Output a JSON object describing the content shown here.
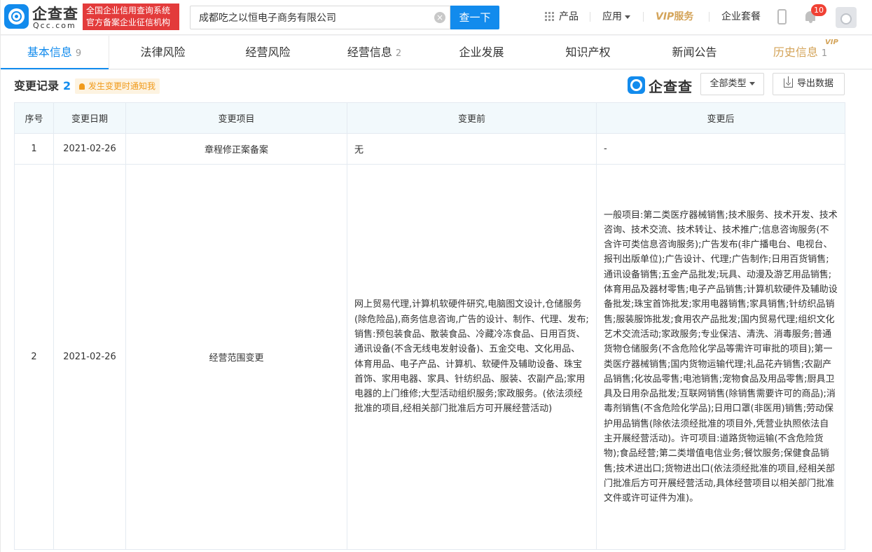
{
  "header": {
    "logo_name": "企查查",
    "logo_sub": "Qcc.com",
    "tagline_line1": "全国企业信用查询系统",
    "tagline_line2": "官方备案企业征信机构",
    "search_value": "成都吃之以恒电子商务有限公司",
    "search_button": "查一下",
    "nav_product": "产品",
    "nav_apps": "应用",
    "nav_vip": "VIP",
    "nav_vip_service": "服务",
    "nav_enterprise": "企业套餐",
    "notification_count": "10"
  },
  "tabs": [
    {
      "label": "基本信息",
      "count": "9"
    },
    {
      "label": "法律风险",
      "count": ""
    },
    {
      "label": "经营风险",
      "count": ""
    },
    {
      "label": "经营信息",
      "count": "2"
    },
    {
      "label": "企业发展",
      "count": ""
    },
    {
      "label": "知识产权",
      "count": ""
    },
    {
      "label": "新闻公告",
      "count": ""
    },
    {
      "label": "历史信息",
      "count": "1"
    }
  ],
  "vip_tag": "VIP",
  "section": {
    "title": "变更记录",
    "count": "2",
    "notify_label": "发生变更时通知我",
    "watermark": "企查查",
    "filter_label": "全部类型",
    "export_label": "导出数据"
  },
  "table": {
    "headers": [
      "序号",
      "变更日期",
      "变更项目",
      "变更前",
      "变更后"
    ],
    "rows": [
      {
        "index": "1",
        "date": "2021-02-26",
        "item": "章程修正案备案",
        "before": "无",
        "after": "-"
      },
      {
        "index": "2",
        "date": "2021-02-26",
        "item": "经营范围变更",
        "before": "网上贸易代理,计算机软硬件研究,电脑图文设计,仓储服务(除危险品),商务信息咨询,广告的设计、制作、代理、发布;销售:预包装食品、散装食品、冷藏冷冻食品、日用百货、通讯设备(不含无线电发射设备)、五金交电、文化用品、体育用品、电子产品、计算机、软硬件及辅助设备、珠宝首饰、家用电器、家具、针纺织品、服装、农副产品;家用电器的上门维修;大型活动组织服务;家政服务。(依法须经批准的项目,经相关部门批准后方可开展经营活动)",
        "after": "一般项目:第二类医疗器械销售;技术服务、技术开发、技术咨询、技术交流、技术转让、技术推广;信息咨询服务(不含许可类信息咨询服务);广告发布(非广播电台、电视台、报刊出版单位);广告设计、代理;广告制作;日用百货销售;通讯设备销售;五金产品批发;玩具、动漫及游艺用品销售;体育用品及器材零售;电子产品销售;计算机软硬件及辅助设备批发;珠宝首饰批发;家用电器销售;家具销售;针纺织品销售;服装服饰批发;食用农产品批发;国内贸易代理;组织文化艺术交流活动;家政服务;专业保洁、清洗、消毒服务;普通货物仓储服务(不含危险化学品等需许可审批的项目);第一类医疗器械销售;国内货物运输代理;礼品花卉销售;农副产品销售;化妆品零售;电池销售;宠物食品及用品零售;厨具卫具及日用杂品批发;互联网销售(除销售需要许可的商品);消毒剂销售(不含危险化学品);日用口罩(非医用)销售;劳动保护用品销售(除依法须经批准的项目外,凭营业执照依法自主开展经营活动)。许可项目:道路货物运输(不含危险货物);食品经营;第二类增值电信业务;餐饮服务;保健食品销售;技术进出口;货物进出口(依法须经批准的项目,经相关部门批准后方可开展经营活动,具体经营项目以相关部门批准文件或许可证件为准)。"
      }
    ]
  },
  "colors": {
    "brand": "#128bed",
    "highlight_red": "#e33b3b",
    "vip_gold": "#d4a45a"
  }
}
